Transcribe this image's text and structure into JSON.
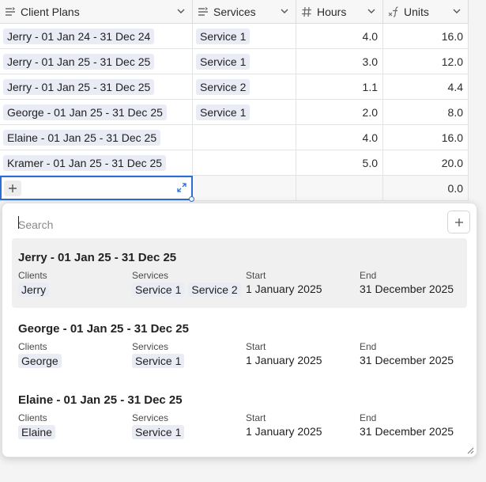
{
  "columns": [
    {
      "name": "Client Plans",
      "icon": "linked-record-icon"
    },
    {
      "name": "Services",
      "icon": "linked-record-icon"
    },
    {
      "name": "Hours",
      "icon": "number-icon"
    },
    {
      "name": "Units",
      "icon": "formula-icon"
    }
  ],
  "rows": [
    {
      "plan": "Jerry - 01 Jan 24 - 31 Dec 24",
      "service": "Service 1",
      "hours": "4.0",
      "units": "16.0"
    },
    {
      "plan": "Jerry - 01 Jan 25 - 31 Dec 25",
      "service": "Service 1",
      "hours": "3.0",
      "units": "12.0"
    },
    {
      "plan": "Jerry - 01 Jan 25 - 31 Dec 25",
      "service": "Service 2",
      "hours": "1.1",
      "units": "4.4"
    },
    {
      "plan": "George - 01 Jan 25 - 31 Dec 25",
      "service": "Service 1",
      "hours": "2.0",
      "units": "8.0"
    },
    {
      "plan": "Elaine - 01 Jan 25 - 31 Dec 25",
      "service": "",
      "hours": "4.0",
      "units": "16.0"
    },
    {
      "plan": "Kramer - 01 Jan 25 - 31 Dec 25",
      "service": "",
      "hours": "5.0",
      "units": "20.0"
    }
  ],
  "new_row": {
    "units": "0.0"
  },
  "popup": {
    "search_placeholder": "Search",
    "labels": {
      "clients": "Clients",
      "services": "Services",
      "start": "Start",
      "end": "End"
    },
    "items": [
      {
        "title": "Jerry - 01 Jan 25 - 31 Dec 25",
        "client": "Jerry",
        "services": [
          "Service 1",
          "Service 2"
        ],
        "start": "1 January 2025",
        "end": "31 December 2025"
      },
      {
        "title": "George - 01 Jan 25 - 31 Dec 25",
        "client": "George",
        "services": [
          "Service 1"
        ],
        "start": "1 January 2025",
        "end": "31 December 2025"
      },
      {
        "title": "Elaine - 01 Jan 25 - 31 Dec 25",
        "client": "Elaine",
        "services": [
          "Service 1"
        ],
        "start": "1 January 2025",
        "end": "31 December 2025"
      }
    ]
  },
  "colors": {
    "accent": "#2b6cd6",
    "chip": "#e9ecf5",
    "highlight": "#f0f0f0"
  }
}
